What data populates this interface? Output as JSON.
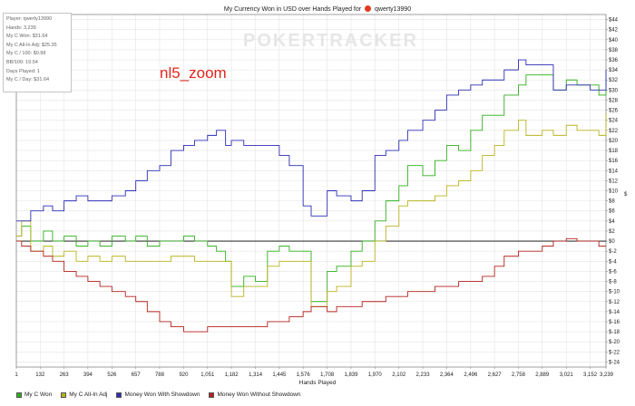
{
  "title": {
    "prefix": "My Currency Won in USD over Hands Played for",
    "player": "qwerty13990"
  },
  "watermark": "POKERTRACKER",
  "annotation": "nl5_zoom",
  "stats": [
    "Player: qwerty13990",
    "Hands: 3,239",
    "My C Won: $31.64",
    "My C All-In Adj: $25.35",
    "My C / 100: $0.98",
    "BB/100: 19.54",
    "Days Played: 1",
    "My C / Day: $31.64"
  ],
  "colors": {
    "won": "#2fae1c",
    "allin": "#b7b41e",
    "showdown": "#2d2db5",
    "nonshowdown": "#b3211b",
    "zero_line": "#000000",
    "grid": "#e4e4e4"
  },
  "chart_data": {
    "type": "line",
    "title": "My Currency Won in USD over Hands Played for qwerty13990",
    "xlabel": "Hands Played",
    "ylabel": "$",
    "xlim": [
      1,
      3239
    ],
    "ylim": [
      -25,
      45
    ],
    "x_ticks": [
      1,
      132,
      263,
      394,
      526,
      657,
      788,
      920,
      1051,
      1182,
      1314,
      1445,
      1576,
      1708,
      1839,
      1970,
      2102,
      2233,
      2364,
      2496,
      2627,
      2758,
      2889,
      3021,
      3152,
      3239
    ],
    "x_tick_labels": [
      "1",
      "132",
      "263",
      "394",
      "526",
      "657",
      "788",
      "920",
      "1,051",
      "1,182",
      "1,314",
      "1,445",
      "1,576",
      "1,708",
      "1,839",
      "1,970",
      "2,102",
      "2,233",
      "2,364",
      "2,496",
      "2,627",
      "2,758",
      "2,889",
      "3,021",
      "3,152",
      "3,239"
    ],
    "y_ticks": [
      -24,
      -22,
      -20,
      -18,
      -16,
      -14,
      -12,
      -10,
      -8,
      -6,
      -4,
      -2,
      0,
      2,
      4,
      6,
      8,
      10,
      12,
      14,
      16,
      18,
      20,
      22,
      24,
      26,
      28,
      30,
      32,
      34,
      36,
      38,
      40,
      42,
      44
    ],
    "y_tick_labels": [
      "$-24",
      "$-22",
      "$-20",
      "$-18",
      "$-16",
      "$-14",
      "$-12",
      "$-10",
      "$-8",
      "$-6",
      "$-4",
      "$-2",
      "$0",
      "$2",
      "$4",
      "$6",
      "$8",
      "$10",
      "$12",
      "$14",
      "$16",
      "$18",
      "$20",
      "$22",
      "$24",
      "$26",
      "$28",
      "$30",
      "$32",
      "$34",
      "$36",
      "$38",
      "$40",
      "$42",
      "$44"
    ],
    "legend_position": "bottom",
    "series": [
      {
        "name": "My C Won",
        "color": "#2fae1c",
        "x": [
          1,
          30,
          80,
          150,
          200,
          263,
          330,
          394,
          460,
          526,
          600,
          657,
          720,
          788,
          850,
          920,
          980,
          1051,
          1100,
          1150,
          1182,
          1250,
          1314,
          1380,
          1445,
          1500,
          1576,
          1620,
          1708,
          1760,
          1839,
          1900,
          1970,
          2030,
          2102,
          2150,
          2233,
          2300,
          2364,
          2430,
          2496,
          2560,
          2627,
          2680,
          2758,
          2800,
          2889,
          2950,
          3021,
          3080,
          3152,
          3200,
          3239
        ],
        "y": [
          1,
          3,
          0,
          2,
          0,
          1,
          -1,
          0,
          -1,
          1,
          0,
          1,
          -1,
          0,
          0,
          1,
          0,
          -1,
          -2,
          -4,
          -9,
          -7,
          -8,
          -2,
          -1,
          -2,
          -2,
          -12,
          -6,
          -5,
          -2,
          0,
          4,
          8,
          11,
          15,
          13,
          16,
          19,
          18,
          22,
          25,
          25,
          29,
          31,
          33,
          33,
          30,
          32,
          31,
          31,
          29,
          31.64
        ]
      },
      {
        "name": "My C All-In Adj",
        "color": "#b7b41e",
        "x": [
          1,
          30,
          80,
          150,
          200,
          263,
          330,
          394,
          460,
          526,
          600,
          657,
          720,
          788,
          850,
          920,
          980,
          1051,
          1100,
          1150,
          1182,
          1250,
          1314,
          1380,
          1445,
          1500,
          1576,
          1620,
          1708,
          1760,
          1839,
          1900,
          1970,
          2030,
          2102,
          2150,
          2233,
          2300,
          2364,
          2430,
          2496,
          2560,
          2627,
          2680,
          2758,
          2800,
          2889,
          2950,
          3021,
          3080,
          3152,
          3200,
          3239
        ],
        "y": [
          1,
          4,
          -2,
          -1,
          -3,
          -2,
          -4,
          -3,
          -4,
          -3,
          -4,
          -4,
          -4,
          -4,
          -3,
          -3,
          -4,
          -4,
          -4,
          -4,
          -11,
          -9,
          -9,
          -5,
          -4,
          -4,
          -4,
          -13,
          -10,
          -9,
          -5,
          -4,
          0,
          3,
          7,
          8,
          8,
          9,
          11,
          12,
          14,
          17,
          19,
          22,
          24,
          21,
          22,
          21,
          23,
          22,
          22,
          21,
          25.35
        ]
      },
      {
        "name": "Money Won With Showdown",
        "color": "#2d2db5",
        "x": [
          1,
          30,
          80,
          150,
          200,
          263,
          330,
          394,
          460,
          526,
          600,
          657,
          720,
          788,
          850,
          920,
          980,
          1051,
          1100,
          1150,
          1182,
          1250,
          1314,
          1380,
          1445,
          1500,
          1576,
          1620,
          1708,
          1760,
          1839,
          1900,
          1970,
          2030,
          2102,
          2150,
          2233,
          2300,
          2364,
          2430,
          2496,
          2560,
          2627,
          2680,
          2758,
          2800,
          2889,
          2950,
          3021,
          3080,
          3152,
          3200,
          3239
        ],
        "y": [
          4,
          4,
          6,
          7,
          6,
          8,
          9,
          8,
          8,
          9,
          10,
          12,
          14,
          15,
          18,
          19,
          20,
          21,
          22,
          19,
          20,
          19,
          19,
          19,
          17,
          15,
          7,
          5,
          10,
          9,
          8,
          10,
          17,
          18,
          20,
          22,
          24,
          26,
          29,
          30,
          31,
          32,
          32,
          34,
          36,
          35,
          35,
          30,
          31,
          31,
          30,
          30,
          34
        ]
      },
      {
        "name": "Money Won Without Showdown",
        "color": "#b3211b",
        "x": [
          1,
          30,
          80,
          150,
          200,
          263,
          330,
          394,
          460,
          526,
          600,
          657,
          720,
          788,
          850,
          920,
          980,
          1051,
          1100,
          1150,
          1182,
          1250,
          1314,
          1380,
          1445,
          1500,
          1576,
          1620,
          1708,
          1760,
          1839,
          1900,
          1970,
          2030,
          2102,
          2150,
          2233,
          2300,
          2364,
          2430,
          2496,
          2560,
          2627,
          2680,
          2758,
          2800,
          2889,
          2950,
          3021,
          3080,
          3152,
          3200,
          3239
        ],
        "y": [
          0,
          -1,
          -2,
          -3,
          -4,
          -6,
          -7,
          -8,
          -9,
          -10,
          -11,
          -12,
          -14,
          -16,
          -17,
          -18,
          -18,
          -17,
          -17,
          -17,
          -17,
          -17,
          -17,
          -16,
          -16,
          -15,
          -14,
          -13,
          -14,
          -13,
          -13,
          -12,
          -12,
          -11,
          -11,
          -10,
          -10,
          -9,
          -9,
          -8,
          -8,
          -7,
          -5,
          -3,
          -2,
          -2,
          -1,
          0,
          0.5,
          0,
          0,
          -1,
          -1
        ]
      }
    ]
  },
  "x_axis_label": "Hands Played",
  "y_axis_label": "$",
  "legend": [
    {
      "label": "My C Won",
      "color": "#2fae1c"
    },
    {
      "label": "My C All-In Adj",
      "color": "#b7b41e"
    },
    {
      "label": "Money Won With Showdown",
      "color": "#2d2db5"
    },
    {
      "label": "Money Won Without Showdown",
      "color": "#b3211b"
    }
  ]
}
